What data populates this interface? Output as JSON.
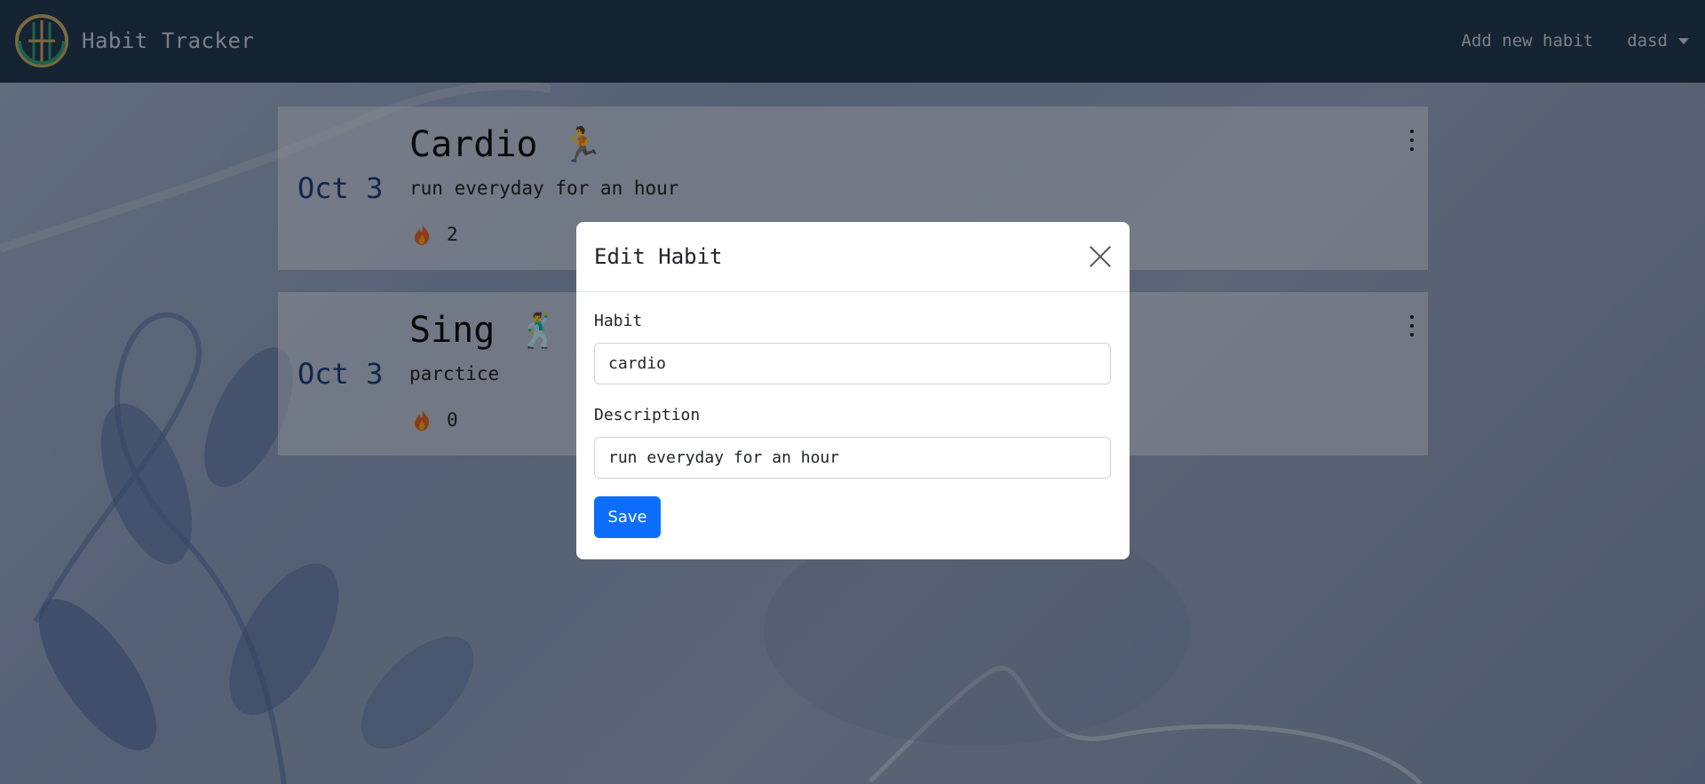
{
  "navbar": {
    "brand_title": "Habit Tracker",
    "add_link": "Add new habit",
    "user_name": "dasd"
  },
  "habits": [
    {
      "date": "Oct 3",
      "title": "Cardio",
      "icon": "🏃",
      "icon_name": "runner-icon",
      "description": "run everyday for an hour",
      "streak": "2"
    },
    {
      "date": "Oct 3",
      "title": "Sing",
      "icon": "🕺",
      "icon_name": "dancer-icon",
      "description": "parctice",
      "streak": "0"
    }
  ],
  "modal": {
    "title": "Edit Habit",
    "habit_label": "Habit",
    "habit_value": "cardio",
    "description_label": "Description",
    "description_value": "run everyday for an hour",
    "save_label": "Save"
  },
  "colors": {
    "navbar": "#233a52",
    "date": "#1f3d7a",
    "primary": "#0d6efd"
  }
}
